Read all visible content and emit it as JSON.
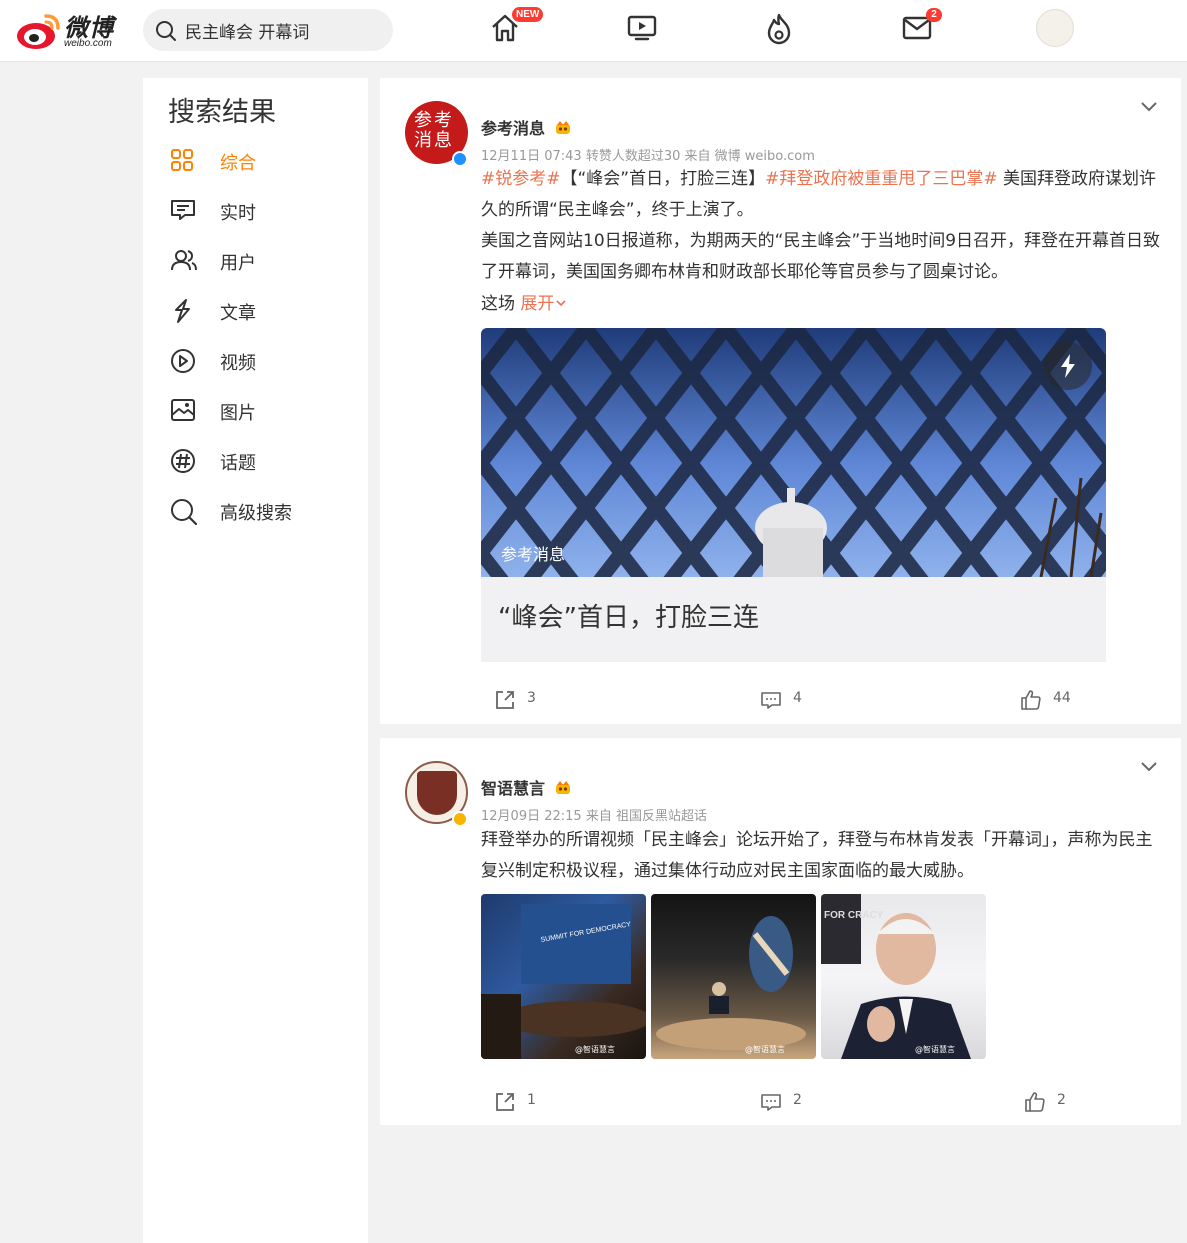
{
  "topbar": {
    "logo_cn": "微博",
    "logo_en": "weibo.com",
    "search_value": "民主峰会 开幕词",
    "home_badge": "NEW",
    "messages_badge": "2"
  },
  "sidebar": {
    "title": "搜索结果",
    "items": [
      {
        "label": "综合",
        "icon": "grid-icon"
      },
      {
        "label": "实时",
        "icon": "chat-icon"
      },
      {
        "label": "用户",
        "icon": "users-icon"
      },
      {
        "label": "文章",
        "icon": "article-icon"
      },
      {
        "label": "视频",
        "icon": "play-icon"
      },
      {
        "label": "图片",
        "icon": "image-icon"
      },
      {
        "label": "话题",
        "icon": "hashtag-icon"
      },
      {
        "label": "高级搜索",
        "icon": "search-icon"
      }
    ]
  },
  "post1": {
    "author": "参考消息",
    "avatar_text": "参考消息",
    "meta": "12月11日 07:43 转赞人数超过30  来自 微博 weibo.com",
    "tag1": "#锐参考#",
    "bracket_text": "【“峰会”首日，打脸三连】",
    "tag2": "#拜登政府被重重甩了三巴掌#",
    "text1": " 美国拜登政府谋划许久的所谓“民主峰会”，终于上演了。",
    "text2": "美国之音网站10日报道称，为期两天的“民主峰会”于当地时间9日召开，拜登在开幕首日致了开幕词，美国国务卿布林肯和财政部长耶伦等官员参与了圆桌讨论。",
    "text3": "这场",
    "expand": "展开",
    "image_label": "参考消息",
    "caption": "“峰会”首日，打脸三连",
    "reposts": "3",
    "comments": "4",
    "likes": "44"
  },
  "post2": {
    "author": "智语慧言",
    "meta": "12月09日 22:15  来自 祖国反黑站超话",
    "text": "拜登举办的所谓视频「民主峰会」论坛开始了，拜登与布林肯发表「开幕词」，声称为民主复兴制定积极议程，通过集体行动应对民主国家面临的最大威胁。",
    "thumb1_sign": "SUMMIT FOR DEMOCRACY",
    "thumb3_sign": "FOR CRACY",
    "watermark": "@智语慧言",
    "reposts": "1",
    "comments": "2",
    "likes": "2"
  }
}
